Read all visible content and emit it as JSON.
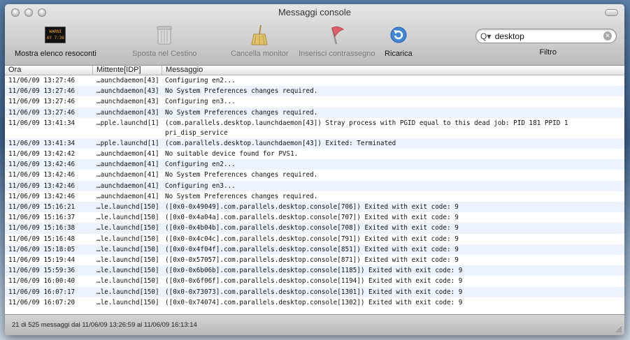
{
  "window": {
    "title": "Messaggi console"
  },
  "toolbar": {
    "show_logs": "Mostra elenco resoconti",
    "show_logs_icon_text": "WARNI\nAY 7:36",
    "trash": "Sposta nel Cestino",
    "clear": "Cancella monitor",
    "mark": "Inserisci contrassegno",
    "reload": "Ricarica",
    "filter_label": "Filtro"
  },
  "search": {
    "value": "desktop"
  },
  "columns": {
    "time": "Ora",
    "sender": "Mittente[IDP]",
    "message": "Messaggio"
  },
  "rows": [
    {
      "time": "11/06/09 13:27:46",
      "sender": "…aunchdaemon[43]",
      "message": "Configuring en2..."
    },
    {
      "time": "11/06/09 13:27:46",
      "sender": "…aunchdaemon[43]",
      "message": "No System Preferences changes required."
    },
    {
      "time": "11/06/09 13:27:46",
      "sender": "…aunchdaemon[43]",
      "message": "Configuring en3..."
    },
    {
      "time": "11/06/09 13:27:46",
      "sender": "…aunchdaemon[43]",
      "message": "No System Preferences changes required."
    },
    {
      "time": "11/06/09 13:41:34",
      "sender": "…pple.launchd[1]",
      "message": "(com.parallels.desktop.launchdaemon[43]) Stray process with PGID equal to this dead job: PID 181 PPID 1 pri_disp_service"
    },
    {
      "time": "11/06/09 13:41:34",
      "sender": "…pple.launchd[1]",
      "message": "(com.parallels.desktop.launchdaemon[43]) Exited: Terminated"
    },
    {
      "time": "11/06/09 13:42:42",
      "sender": "…aunchdaemon[41]",
      "message": "No suitable device found for PVS1."
    },
    {
      "time": "11/06/09 13:42:46",
      "sender": "…aunchdaemon[41]",
      "message": "Configuring en2..."
    },
    {
      "time": "11/06/09 13:42:46",
      "sender": "…aunchdaemon[41]",
      "message": "No System Preferences changes required."
    },
    {
      "time": "11/06/09 13:42:46",
      "sender": "…aunchdaemon[41]",
      "message": "Configuring en3..."
    },
    {
      "time": "11/06/09 13:42:46",
      "sender": "…aunchdaemon[41]",
      "message": "No System Preferences changes required."
    },
    {
      "time": "11/06/09 15:16:21",
      "sender": "…le.launchd[150]",
      "message": "([0x0-0x49049].com.parallels.desktop.console[706]) Exited with exit code: 9"
    },
    {
      "time": "11/06/09 15:16:37",
      "sender": "…le.launchd[150]",
      "message": "([0x0-0x4a04a].com.parallels.desktop.console[707]) Exited with exit code: 9"
    },
    {
      "time": "11/06/09 15:16:38",
      "sender": "…le.launchd[150]",
      "message": "([0x0-0x4b04b].com.parallels.desktop.console[708]) Exited with exit code: 9"
    },
    {
      "time": "11/06/09 15:16:48",
      "sender": "…le.launchd[150]",
      "message": "([0x0-0x4c04c].com.parallels.desktop.console[791]) Exited with exit code: 9"
    },
    {
      "time": "11/06/09 15:18:05",
      "sender": "…le.launchd[150]",
      "message": "([0x0-0x4f04f].com.parallels.desktop.console[851]) Exited with exit code: 9"
    },
    {
      "time": "11/06/09 15:19:44",
      "sender": "…le.launchd[150]",
      "message": "([0x0-0x57057].com.parallels.desktop.console[871]) Exited with exit code: 9"
    },
    {
      "time": "11/06/09 15:59:36",
      "sender": "…le.launchd[150]",
      "message": "([0x0-0x6b06b].com.parallels.desktop.console[1185]) Exited with exit code: 9"
    },
    {
      "time": "11/06/09 16:00:40",
      "sender": "…le.launchd[150]",
      "message": "([0x0-0x6f06f].com.parallels.desktop.console[1194]) Exited with exit code: 9"
    },
    {
      "time": "11/06/09 16:07:17",
      "sender": "…le.launchd[150]",
      "message": "([0x0-0x73073].com.parallels.desktop.console[1301]) Exited with exit code: 9"
    },
    {
      "time": "11/06/09 16:07:20",
      "sender": "…le.launchd[150]",
      "message": "([0x0-0x74074].com.parallels.desktop.console[1302]) Exited with exit code: 9"
    }
  ],
  "status": {
    "text": "21 di 525 messaggi dal 11/06/09 13:26:59 al 11/06/09 16:13:14"
  }
}
